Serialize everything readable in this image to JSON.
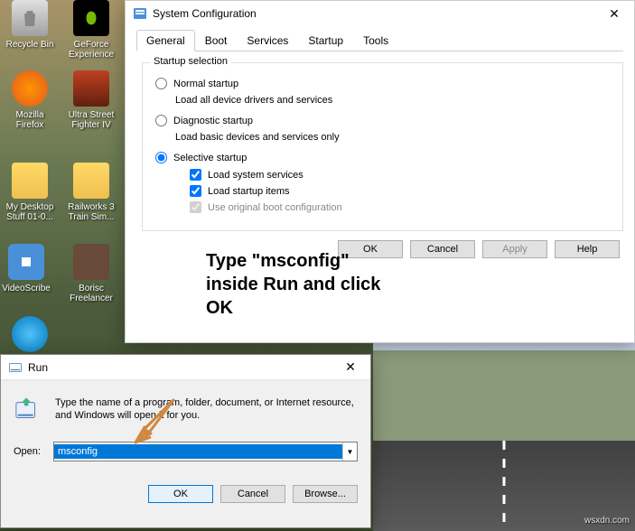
{
  "desktop": {
    "icons": [
      {
        "label": "Recycle Bin",
        "name": "recycle-bin"
      },
      {
        "label": "GeForce Experience",
        "name": "geforce-experience"
      },
      {
        "label": "Mozilla Firefox",
        "name": "mozilla-firefox"
      },
      {
        "label": "Ultra Street Fighter IV",
        "name": "ultra-street-fighter"
      },
      {
        "label": "My Desktop Stuff 01-0...",
        "name": "my-desktop-stuff"
      },
      {
        "label": "Railworks 3 Train Sim...",
        "name": "railworks"
      },
      {
        "label": "VideoScribe",
        "name": "videoscribe"
      },
      {
        "label": "Borisc Freelancer",
        "name": "borisc-freelancer"
      }
    ]
  },
  "sysconfig": {
    "title": "System Configuration",
    "tabs": [
      "General",
      "Boot",
      "Services",
      "Startup",
      "Tools"
    ],
    "active_tab": 0,
    "group_label": "Startup selection",
    "options": {
      "normal": {
        "label": "Normal startup",
        "desc": "Load all device drivers and services"
      },
      "diagnostic": {
        "label": "Diagnostic startup",
        "desc": "Load basic devices and services only"
      },
      "selective": {
        "label": "Selective startup"
      }
    },
    "checks": {
      "sysservices": "Load system services",
      "startupitems": "Load startup items",
      "bootcfg": "Use original boot configuration"
    },
    "buttons": {
      "ok": "OK",
      "cancel": "Cancel",
      "apply": "Apply",
      "help": "Help"
    }
  },
  "annotation": {
    "line1": "Type \"msconfig\"",
    "line2": "inside Run and click",
    "line3": "OK"
  },
  "run": {
    "title": "Run",
    "desc": "Type the name of a program, folder, document, or Internet resource, and Windows will open it for you.",
    "open_label": "Open:",
    "value": "msconfig",
    "buttons": {
      "ok": "OK",
      "cancel": "Cancel",
      "browse": "Browse..."
    }
  },
  "watermark": "wsxdn.com"
}
